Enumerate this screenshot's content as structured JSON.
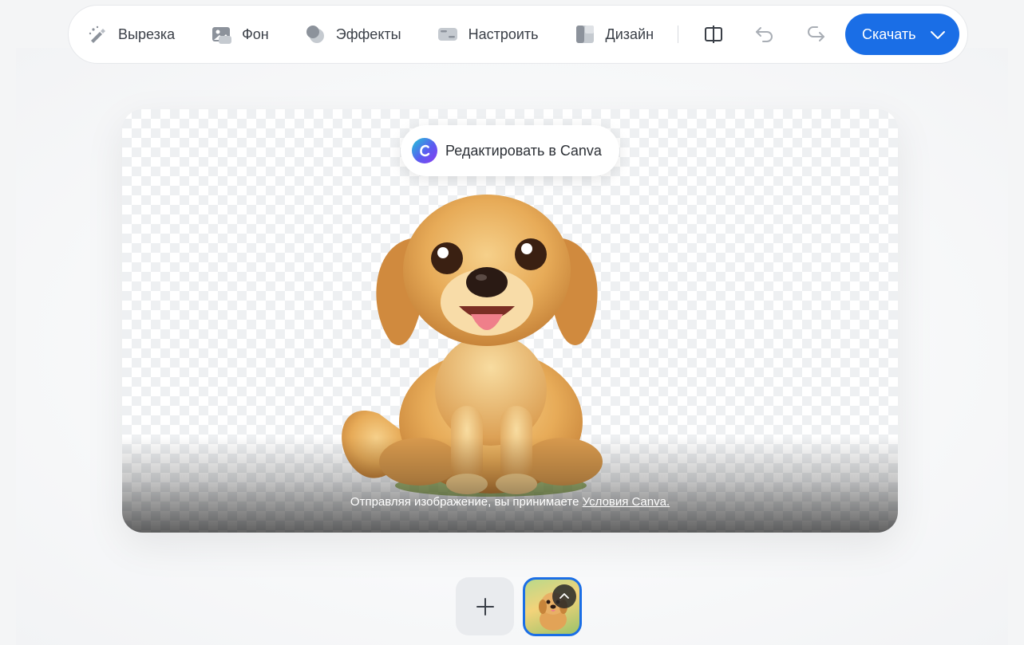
{
  "toolbar": {
    "cutout_label": "Вырезка",
    "background_label": "Фон",
    "effects_label": "Эффекты",
    "adjust_label": "Настроить",
    "design_label": "Дизайн",
    "download_label": "Скачать"
  },
  "canvas": {
    "edit_in_canva_label": "Редактировать в Canva",
    "terms_text": "Отправляя изображение, вы принимаете ",
    "terms_link": "Условия Canva."
  },
  "colors": {
    "accent": "#1a6ee6",
    "toolbar_bg": "#ffffff",
    "page_bg": "#f4f5f6"
  },
  "icons": {
    "cutout": "magic-brush-icon",
    "background": "image-icon",
    "effects": "circles-icon",
    "adjust": "adjust-icon",
    "design": "layout-icon",
    "compare": "compare-icon",
    "undo": "undo-icon",
    "redo": "redo-icon",
    "download_chevron": "chevron-down-icon",
    "add": "plus-icon",
    "thumb_expand": "chevron-up-icon"
  }
}
